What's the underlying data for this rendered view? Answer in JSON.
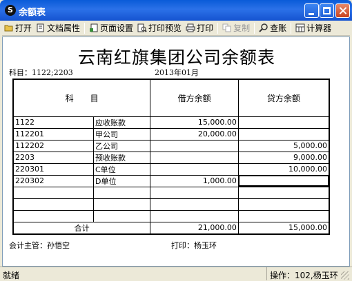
{
  "window": {
    "title": "余额表",
    "icon_letter": "S"
  },
  "toolbar": {
    "open": "打开",
    "doc_props": "文档属性",
    "page_setup": "页面设置",
    "print_preview": "打印预览",
    "print": "打印",
    "copy": "复制",
    "check": "查账",
    "calculator": "计算器"
  },
  "report": {
    "title": "云南红旗集团公司余额表",
    "subject_line": "科目：1122;2203",
    "period": "2013年01月",
    "headers": {
      "subject": "科　　目",
      "debit": "借方余额",
      "credit": "贷方余额"
    },
    "rows": [
      {
        "code": "1122",
        "name": "应收账款",
        "debit": "15,000.00",
        "credit": ""
      },
      {
        "code": "112201",
        "name": "甲公司",
        "debit": "20,000.00",
        "credit": ""
      },
      {
        "code": "112202",
        "name": "乙公司",
        "debit": "",
        "credit": "5,000.00"
      },
      {
        "code": "2203",
        "name": "预收账款",
        "debit": "",
        "credit": "9,000.00"
      },
      {
        "code": "220301",
        "name": "C单位",
        "debit": "",
        "credit": "10,000.00"
      },
      {
        "code": "220302",
        "name": "D单位",
        "debit": "1,000.00",
        "credit": ""
      },
      {
        "code": "",
        "name": "",
        "debit": "",
        "credit": ""
      },
      {
        "code": "",
        "name": "",
        "debit": "",
        "credit": ""
      },
      {
        "code": "",
        "name": "",
        "debit": "",
        "credit": ""
      }
    ],
    "total": {
      "label": "合计",
      "debit": "21,000.00",
      "credit": "15,000.00"
    },
    "accountant": "会计主管：孙悟空",
    "printer": "打印：杨玉环"
  },
  "status": {
    "left": "就绪",
    "right": "操作：102,杨玉环"
  }
}
